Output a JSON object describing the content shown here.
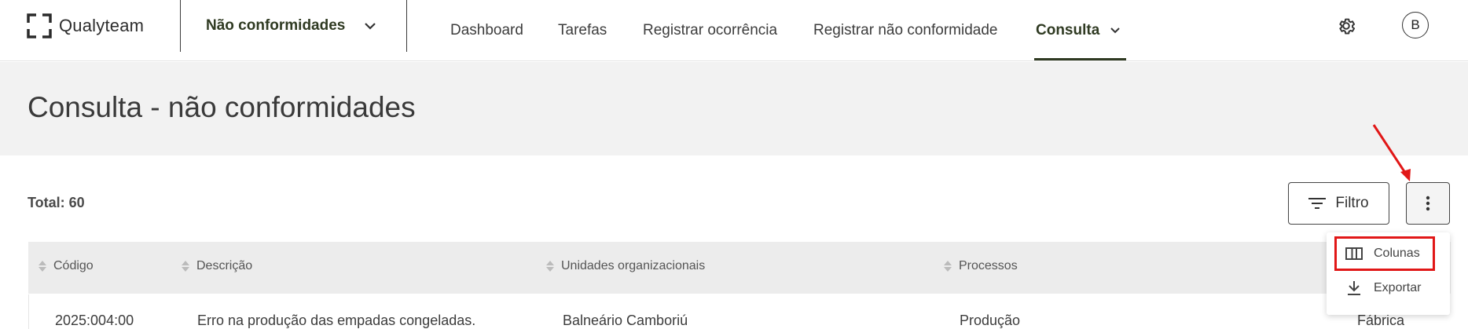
{
  "header": {
    "logo_text": "Qualyteam",
    "module_label": "Não conformidades",
    "nav": [
      "Dashboard",
      "Tarefas",
      "Registrar ocorrência",
      "Registrar não conformidade"
    ],
    "nav_active": "Consulta",
    "avatar_initial": "B"
  },
  "page": {
    "title": "Consulta - não conformidades",
    "total": "Total: 60"
  },
  "toolbar": {
    "filter_label": "Filtro"
  },
  "table": {
    "columns": [
      "Código",
      "Descrição",
      "Unidades organizacionais",
      "Processos"
    ],
    "rows": [
      [
        "2025:004:00",
        "Erro na produção das empadas congeladas.",
        "Balneário Camboriú",
        "Produção",
        "Fábrica"
      ]
    ]
  },
  "menu": {
    "items": [
      "Colunas",
      "Exportar"
    ]
  },
  "colors": {
    "accent": "#2f3a22",
    "highlight": "#e11717",
    "banner": "#f2f2f2"
  }
}
